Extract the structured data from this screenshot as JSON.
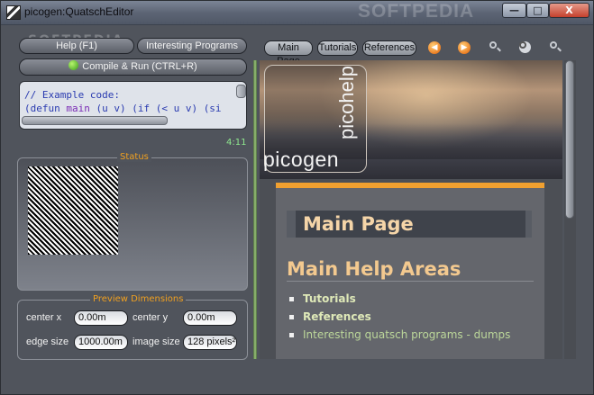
{
  "window": {
    "title": "picogen:QuatschEditor",
    "watermark": "SOFTPEDIA"
  },
  "titlebar_buttons": {
    "minimize": "—",
    "maximize": "□",
    "close": "X"
  },
  "toolbar": {
    "help_label": "Help (F1)",
    "interesting_label": "Interesting Programs",
    "compile_label": "Compile & Run (CTRL+R)",
    "watermark_small": "SOFTPEDIA"
  },
  "code": {
    "line1": "// Example code:",
    "line2_a": "(defun ",
    "line2_fn": "main",
    "line2_b": " (u v) (if (< u v) (si",
    "cursor_position": "4:11"
  },
  "status": {
    "title": "Status"
  },
  "preview": {
    "title": "Preview Dimensions",
    "center_x_label": "center x",
    "center_x_value": "0.00m",
    "center_y_label": "center y",
    "center_y_value": "0.00m",
    "edge_size_label": "edge size",
    "edge_size_value": "1000.00m",
    "image_size_label": "image size",
    "image_size_value": "128 pixels²"
  },
  "help_nav": {
    "tabs": [
      "Main Page",
      "Tutorials",
      "References"
    ],
    "icons": [
      "back-icon",
      "forward-icon",
      "zoom-out-icon",
      "zoom-reset-icon",
      "zoom-in-icon"
    ]
  },
  "help_page": {
    "logo_main": "picogen",
    "logo_vertical": "picohelp",
    "page_title": "Main Page",
    "section_title": "Main Help Areas",
    "items": [
      {
        "label": "Tutorials",
        "style": "bold"
      },
      {
        "label": "References",
        "style": "bold"
      },
      {
        "label": "Interesting quatsch programs - dumps",
        "style": "link"
      }
    ]
  },
  "colors": {
    "accent_orange": "#f0a030",
    "cursor_green": "#8fe88f",
    "group_title": "#f0a020"
  }
}
